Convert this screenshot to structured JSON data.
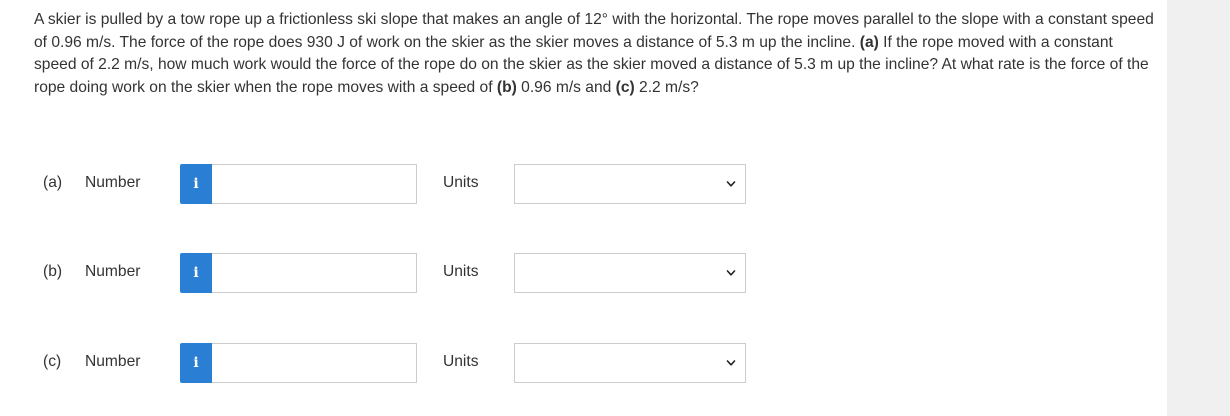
{
  "question": {
    "text_1": "A skier is pulled by a tow rope up a frictionless ski slope that makes an angle of 12° with the horizontal. The rope moves parallel to the slope with a constant speed of 0.96 m/s. The force of the rope does 930 J of work on the skier as the skier moves a distance of 5.3 m up the incline. ",
    "label_a": "(a)",
    "text_2": " If the rope moved with a constant speed of 2.2 m/s, how much work would the force of the rope do on the skier as the skier moved a distance of 5.3 m up the incline? At what rate is the force of the rope doing work on the skier when the rope moves with a speed of ",
    "label_b": "(b)",
    "text_3": " 0.96 m/s and ",
    "label_c": "(c)",
    "text_4": " 2.2 m/s?"
  },
  "answers": [
    {
      "part": "(a)",
      "number_label": "Number",
      "info_icon": "i",
      "number_value": "",
      "units_label": "Units",
      "units_selected": ""
    },
    {
      "part": "(b)",
      "number_label": "Number",
      "info_icon": "i",
      "number_value": "",
      "units_label": "Units",
      "units_selected": ""
    },
    {
      "part": "(c)",
      "number_label": "Number",
      "info_icon": "i",
      "number_value": "",
      "units_label": "Units",
      "units_selected": ""
    }
  ],
  "colors": {
    "info_button": "#2a7fd4",
    "text": "#333333",
    "border": "#cccccc",
    "background_outer": "#f0f0f0",
    "panel": "#ffffff"
  },
  "icons": {
    "info": "info-icon",
    "dropdown": "chevron-down-icon"
  }
}
